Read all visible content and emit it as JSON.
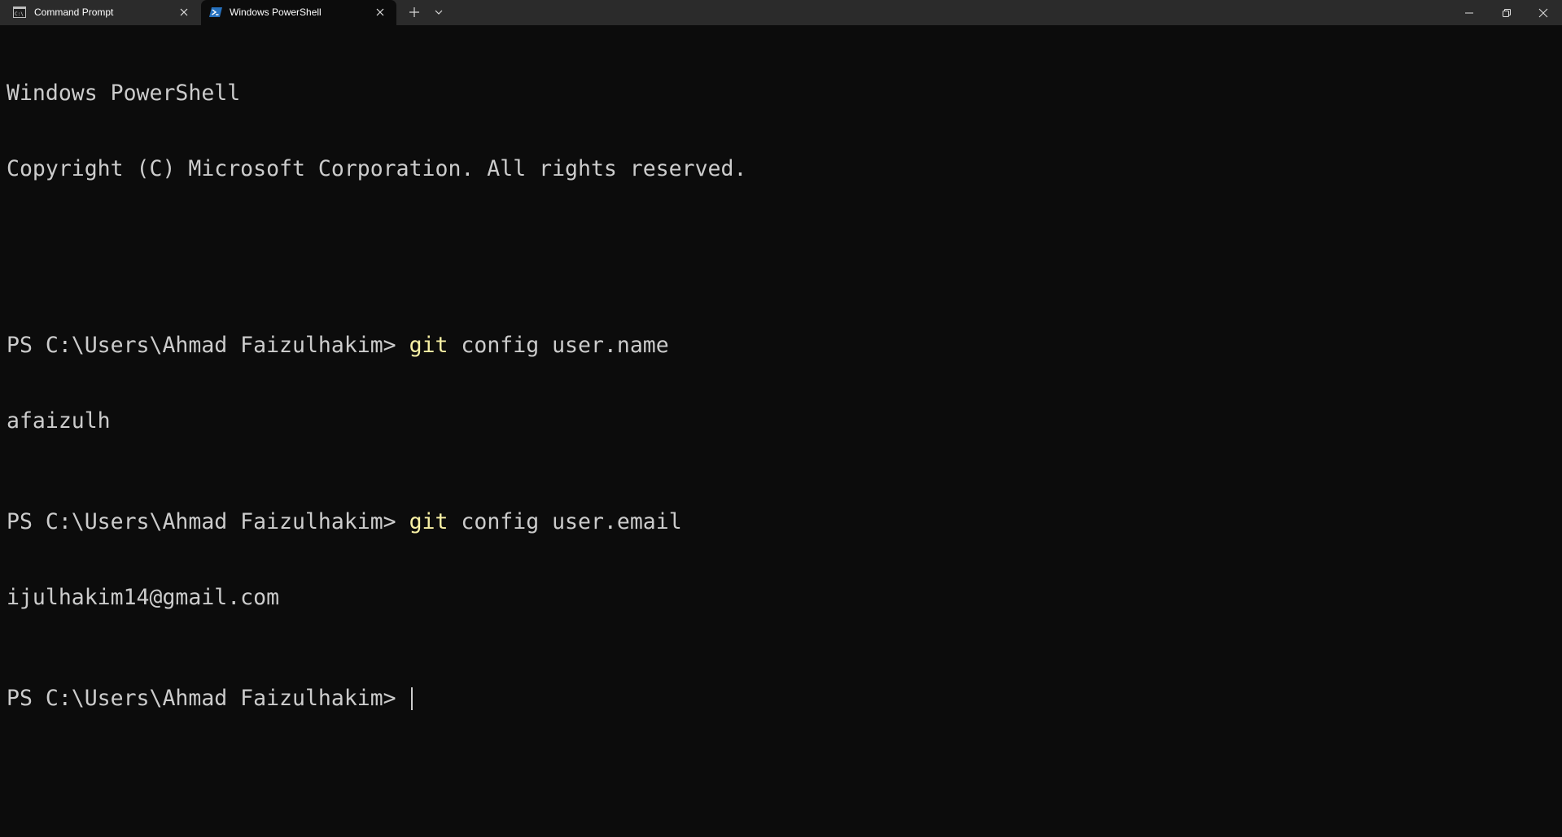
{
  "tabs": [
    {
      "label": "Command Prompt",
      "icon": "cmd-icon",
      "active": false
    },
    {
      "label": "Windows PowerShell",
      "icon": "powershell-icon",
      "active": true
    }
  ],
  "toolbar": {
    "new_tab_icon": "plus-icon",
    "dropdown_icon": "chevron-down-icon"
  },
  "window_controls": {
    "minimize_icon": "minimize-icon",
    "restore_icon": "restore-icon",
    "close_icon": "close-icon"
  },
  "terminal": {
    "header_line1": "Windows PowerShell",
    "header_line2": "Copyright (C) Microsoft Corporation. All rights reserved.",
    "prompt": "PS C:\\Users\\Ahmad Faizulhakim> ",
    "commands": [
      {
        "keyword": "git",
        "args": " config user.name",
        "output": "afaizulh"
      },
      {
        "keyword": "git",
        "args": " config user.email",
        "output": "ijulhakim14@gmail.com"
      }
    ],
    "final_prompt": "PS C:\\Users\\Ahmad Faizulhakim> "
  },
  "colors": {
    "background": "#0c0c0c",
    "titlebar": "#2b2b2b",
    "text": "#cccccc",
    "command_keyword": "#f9f1a5",
    "powershell_icon": "#2671be"
  }
}
